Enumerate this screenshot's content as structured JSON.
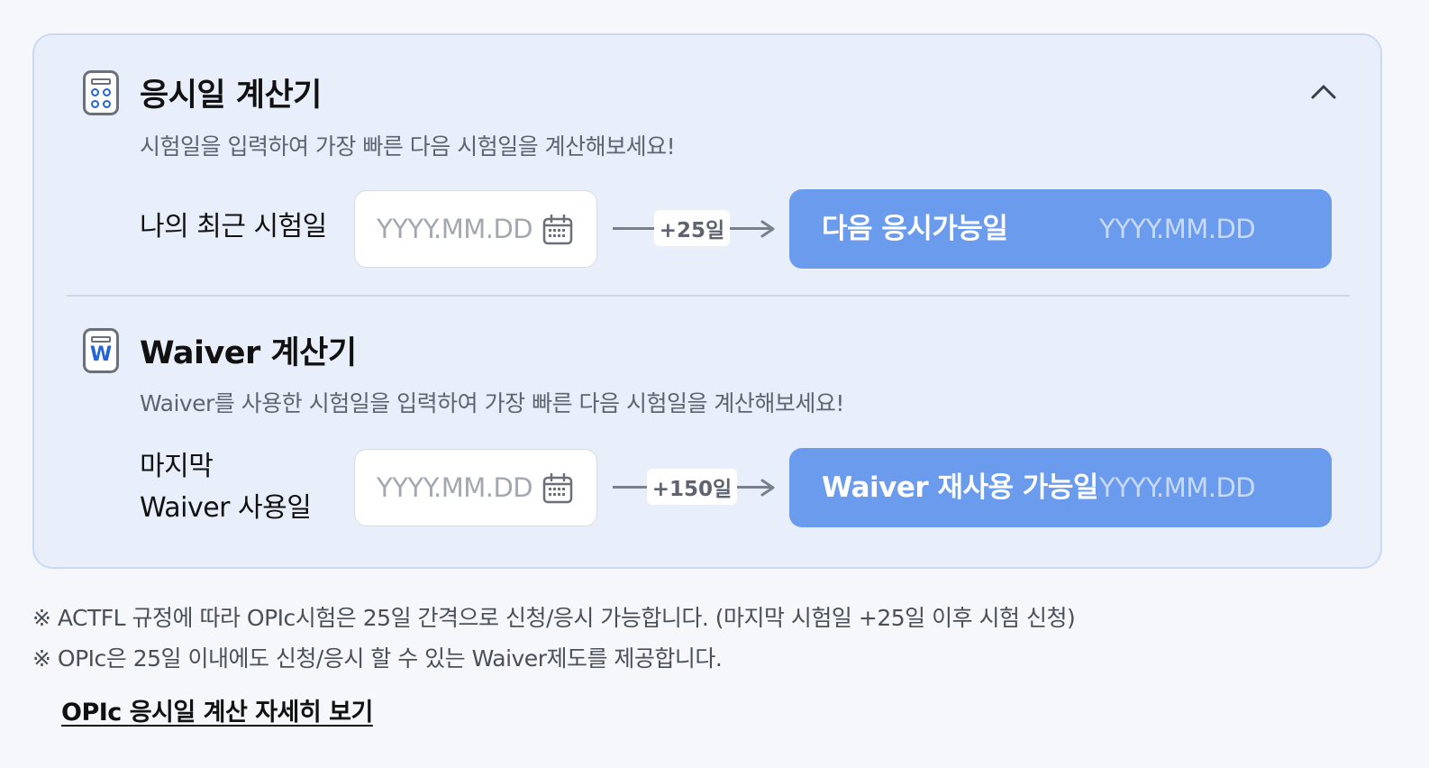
{
  "calculator_panel": {
    "exam_date_calc": {
      "icon": "calculator-icon",
      "title": "응시일 계산기",
      "description": "시험일을 입력하여 가장 빠른 다음 시험일을 계산해보세요!",
      "collapse_icon": "chevron-up-icon",
      "input_label": "나의 최근 시험일",
      "input_placeholder": "YYYY.MM.DD",
      "offset_label": "+25일",
      "result_label": "다음 응시가능일",
      "result_value": "YYYY.MM.DD"
    },
    "waiver_calc": {
      "icon": "waiver-calculator-icon",
      "title": "Waiver 계산기",
      "description": "Waiver를 사용한 시험일을 입력하여 가장 빠른 다음 시험일을 계산해보세요!",
      "input_label_line1": "마지막",
      "input_label_line2": "Waiver 사용일",
      "input_placeholder": "YYYY.MM.DD",
      "offset_label": "+150일",
      "result_label": "Waiver 재사용 가능일",
      "result_value": "YYYY.MM.DD"
    }
  },
  "notes": [
    "※ ACTFL 규정에 따라 OPIc시험은 25일 간격으로 신청/응시 가능합니다. (마지막 시험일 +25일 이후 시험 신청)",
    "※ OPIc은 25일 이내에도 신청/응시 할 수 있는 Waiver제도를 제공합니다."
  ],
  "detail_link": "OPIc 응시일 계산 자세히 보기",
  "colors": {
    "panel_bg": "#e8effb",
    "result_button": "#6a9bec",
    "icon_accent": "#2563d9"
  }
}
